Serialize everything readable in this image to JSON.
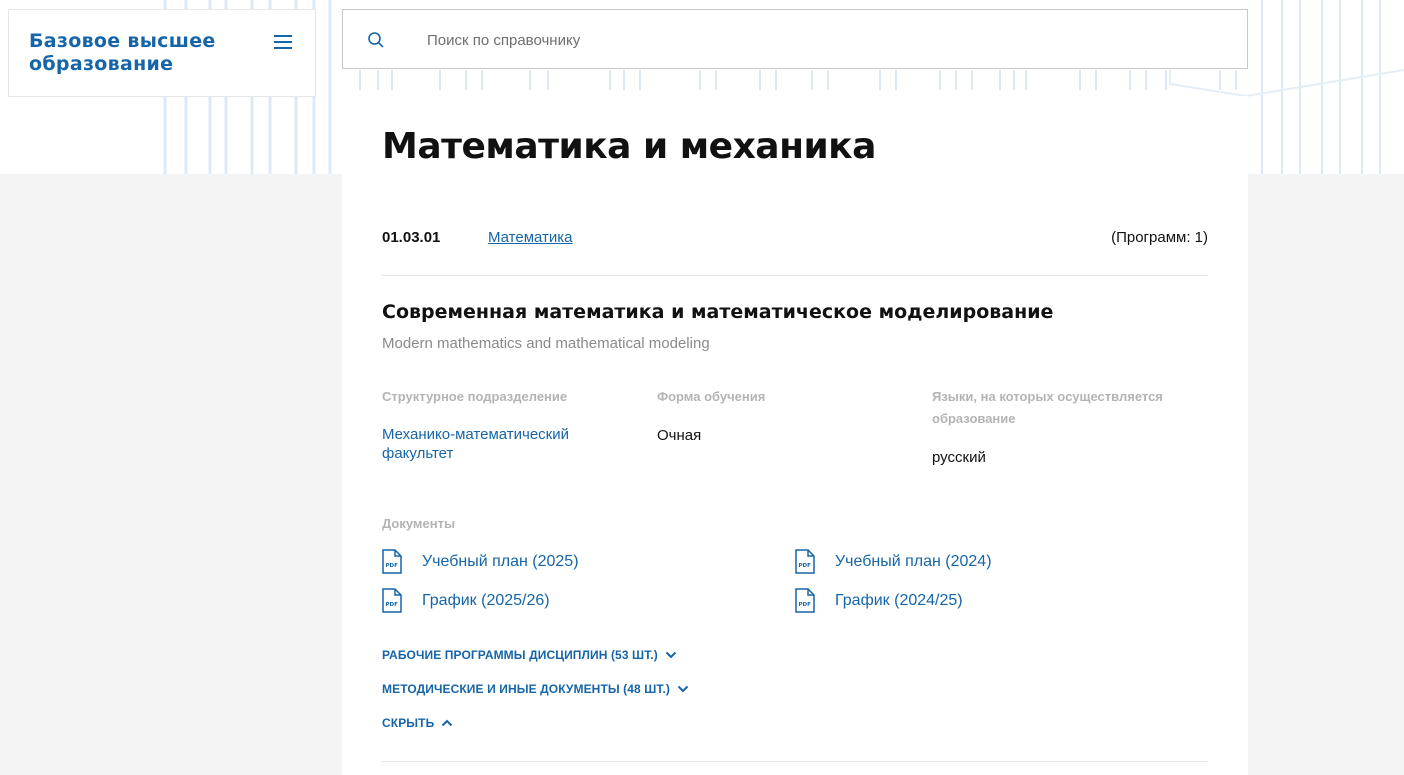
{
  "brand": {
    "title": "Базовое высшее образование"
  },
  "search": {
    "placeholder": "Поиск по справочнику"
  },
  "page": {
    "title": "Математика и механика"
  },
  "direction": {
    "code": "01.03.01",
    "name": "Математика",
    "count_label": "(Программ: 1)"
  },
  "program": {
    "title": "Современная математика и математическое моделирование",
    "subtitle": "Modern mathematics and mathematical modeling",
    "fields": {
      "division_label": "Структурное подразделение",
      "division_value": "Механико-математический факультет",
      "form_label": "Форма обучения",
      "form_value": "Очная",
      "lang_label": "Языки, на которых осуществляется образование",
      "lang_value": "русский"
    },
    "documents_label": "Документы",
    "documents": [
      {
        "label": "Учебный план (2025)",
        "icon": "pdf-icon"
      },
      {
        "label": "Учебный план (2024)",
        "icon": "pdf-icon"
      },
      {
        "label": "График (2025/26)",
        "icon": "pdf-icon"
      },
      {
        "label": "График (2024/25)",
        "icon": "pdf-icon"
      }
    ],
    "toggles": [
      {
        "label": "РАБОЧИЕ ПРОГРАММЫ ДИСЦИПЛИН (53 ШТ.)",
        "icon": "chevron-down-icon"
      },
      {
        "label": "МЕТОДИЧЕСКИЕ И ИНЫЕ ДОКУМЕНТЫ (48 ШТ.)",
        "icon": "chevron-down-icon"
      },
      {
        "label": "СКРЫТЬ",
        "icon": "chevron-up-icon"
      }
    ]
  },
  "colors": {
    "accent": "#1565a8",
    "background": "#f4f4f4",
    "label": "#b4b4b4"
  }
}
